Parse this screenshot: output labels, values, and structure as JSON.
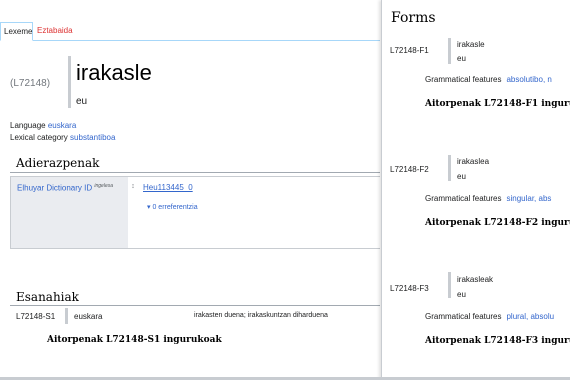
{
  "tabs": {
    "lexeme": "Lexeme",
    "discussion": "Eztabaida"
  },
  "lexeme": {
    "id": "(L72148)",
    "lemma": "irakasle",
    "lemma_language": "eu",
    "language_label": "Language",
    "language_value": "euskara",
    "category_label": "Lexical category",
    "category_value": "substantiboa"
  },
  "statements": {
    "title": "Adierazpenak",
    "property": "Elhuyar Dictionary ID",
    "property_lang": "ingelesa",
    "value": "Heu113445_0",
    "references": "0 erreferentzia"
  },
  "senses": {
    "title": "Esanahiak",
    "items": [
      {
        "id": "L72148-S1",
        "language": "euskara",
        "gloss": "irakasten duena; irakaskuntzan diharduena",
        "pronunciation": "Aitorpenak L72148-S1 ingurukoak"
      }
    ]
  },
  "forms": {
    "title": "Forms",
    "grammatical_label": "Grammatical features",
    "items": [
      {
        "id": "L72148-F1",
        "representation": "irakasle",
        "language": "eu",
        "features": "absolutibo, n",
        "statements": "Aitorpenak L72148-F1 ingurukoak"
      },
      {
        "id": "L72148-F2",
        "representation": "irakaslea",
        "language": "eu",
        "features": "singular, abs",
        "statements": "Aitorpenak L72148-F2 ingurukoak"
      },
      {
        "id": "L72148-F3",
        "representation": "irakasleak",
        "language": "eu",
        "features": "plural, absolu",
        "statements": "Aitorpenak L72148-F3 ingurukoak"
      }
    ]
  }
}
